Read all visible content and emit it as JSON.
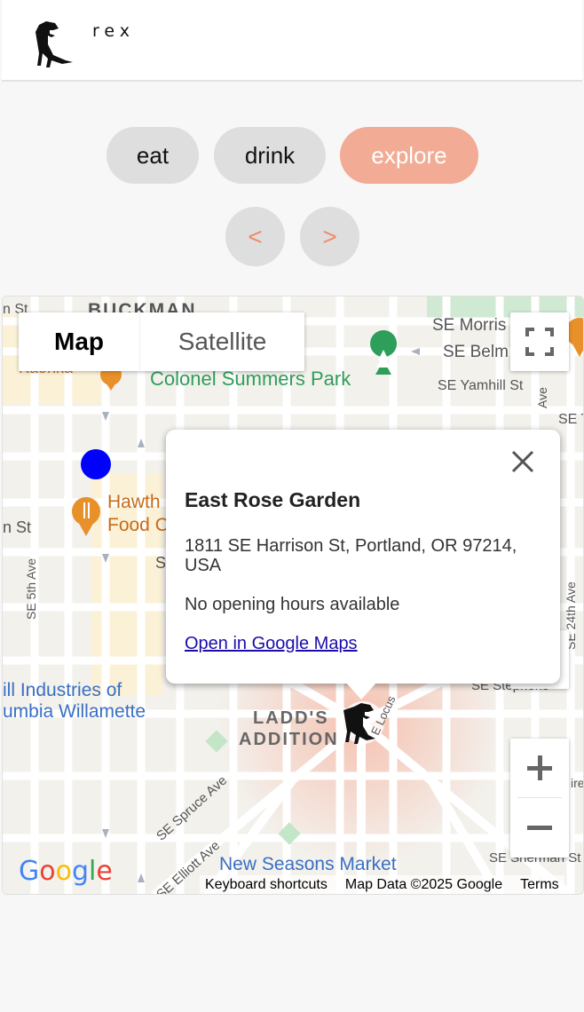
{
  "header": {
    "logo_text": "rex"
  },
  "categories": {
    "eat": "eat",
    "drink": "drink",
    "explore": "explore"
  },
  "nav": {
    "prev": "<",
    "next": ">"
  },
  "map": {
    "type_map": "Map",
    "type_satellite": "Satellite",
    "labels": {
      "buckman": "BUCKMAN",
      "se_morrison": "SE Morris",
      "se_belmont": "SE Belm",
      "kaonka": "Kaonka",
      "colonel_summers": "Colonel Summers Park",
      "se_yamhill": "SE Yamhill St",
      "se_t": "SE T",
      "n_st_top": "n St",
      "n_st": "n St",
      "hawth": "Hawth",
      "food": "Food C",
      "s_partial": "S",
      "se_5th": "SE 5th Ave",
      "se_24th": "SE 24th Ave",
      "industries_1": "ill Industries of",
      "industries_2": "umbia Willamette",
      "ladds_1": "LADD'S",
      "ladds_2": "ADDITION",
      "se_locust": "E Locus",
      "se_spruce": "SE Spruce Ave",
      "se_elliott": "SE Elliott Ave",
      "se_stephens": "SE Stephens",
      "se_sherman": "SE Sherman St",
      "new_seasons": "New Seasons Market",
      "ave_right": "Ave",
      "ire": "ire"
    },
    "google_logo": "Google",
    "attribution": {
      "shortcuts": "Keyboard shortcuts",
      "data": "Map Data ©2025 Google",
      "terms": "Terms"
    },
    "colors": {
      "accent": "#f2ab94",
      "accent_text": "#ef8a6b",
      "user_dot": "#0000ff",
      "park_green": "#2e9e5b",
      "poi_orange": "#e8902a"
    }
  },
  "infowindow": {
    "title": "East Rose Garden",
    "address": "1811 SE Harrison St, Portland, OR 97214, USA",
    "hours": "No opening hours available",
    "link": "Open in Google Maps"
  }
}
